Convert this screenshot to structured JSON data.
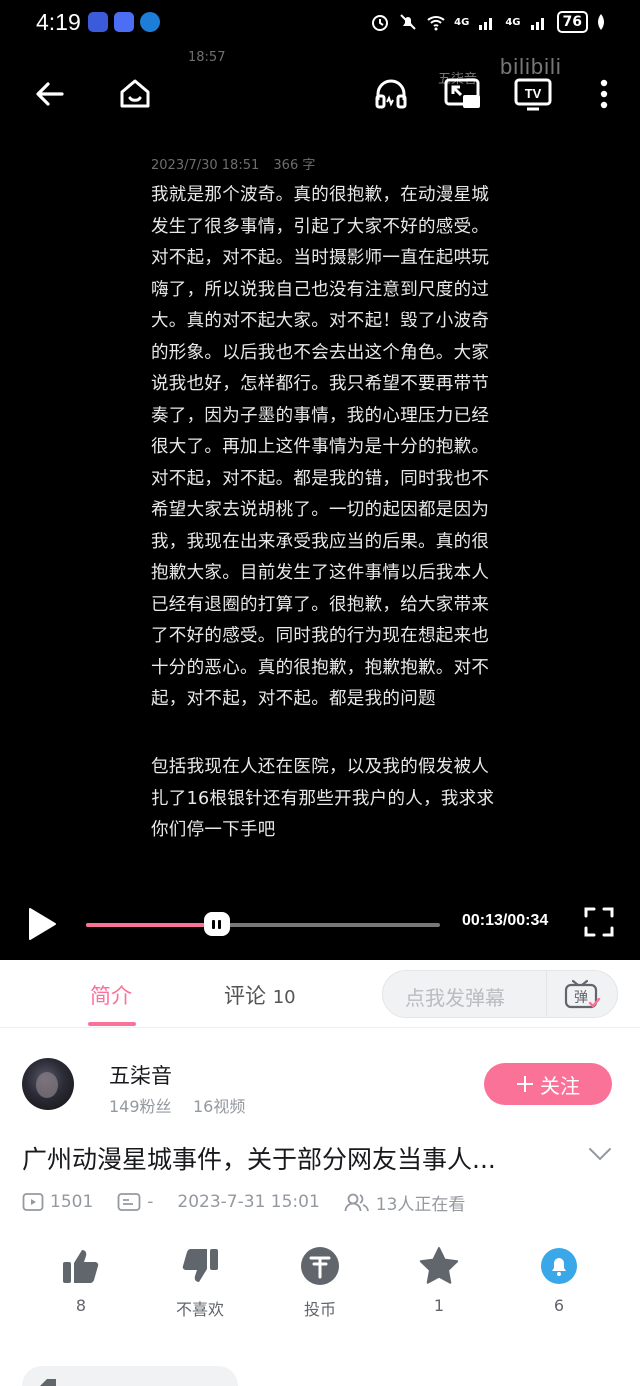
{
  "status_bar": {
    "time": "4:19",
    "battery": "76",
    "net1": "4G",
    "net2": "4G"
  },
  "video": {
    "ghost_status_time": "18:57",
    "ghost_date": "2023/7/30 18:51",
    "ghost_wordcount": "366 字",
    "ghost_uploader": "五柒音",
    "statement_p1": "我就是那个波奇。真的很抱歉，在动漫星城\n发生了很多事情，引起了大家不好的感受。\n对不起，对不起。当时摄影师一直在起哄玩\n嗨了，所以说我自己也没有注意到尺度的过\n大。真的对不起大家。对不起！毁了小波奇\n的形象。以后我也不会去出这个角色。大家\n说我也好，怎样都行。我只希望不要再带节\n奏了，因为子墨的事情，我的心理压力已经\n很大了。再加上这件事情为是十分的抱歉。\n对不起，对不起。都是我的错，同时我也不\n希望大家去说胡桃了。一切的起因都是因为\n我，我现在出来承受我应当的后果。真的很\n抱歉大家。目前发生了这件事情以后我本人\n已经有退圈的打算了。很抱歉，给大家带来\n了不好的感受。同时我的行为现在想起来也\n十分的恶心。真的很抱歉，抱歉抱歉。对不\n起，对不起，对不起。都是我的问题",
    "statement_p2": "包括我现在人还在医院，以及我的假发被人\n扎了16根银针还有那些开我户的人，我求求\n你们停一下手吧",
    "time_display": "00:13/00:34",
    "progress": 0.37
  },
  "tabs": {
    "intro": "简介",
    "comments": "评论",
    "comments_count": "10",
    "danmaku_placeholder": "点我发弹幕",
    "danmaku_icon_label": "弹"
  },
  "uploader": {
    "name": "五柒音",
    "fans": "149粉丝",
    "videos": "16视频",
    "follow_label": "关注"
  },
  "video_info": {
    "title": "广州动漫星城事件，关于部分网友当事人...",
    "plays": "1501",
    "danmaku_count": "-",
    "datetime": "2023-7-31 15:01",
    "watching": "13人正在看"
  },
  "actions": {
    "like": "8",
    "dislike": "不喜欢",
    "coin": "投币",
    "favorite": "1",
    "share": "6"
  },
  "colors": {
    "accent": "#fb7299",
    "share_blue": "#39a7e8"
  }
}
